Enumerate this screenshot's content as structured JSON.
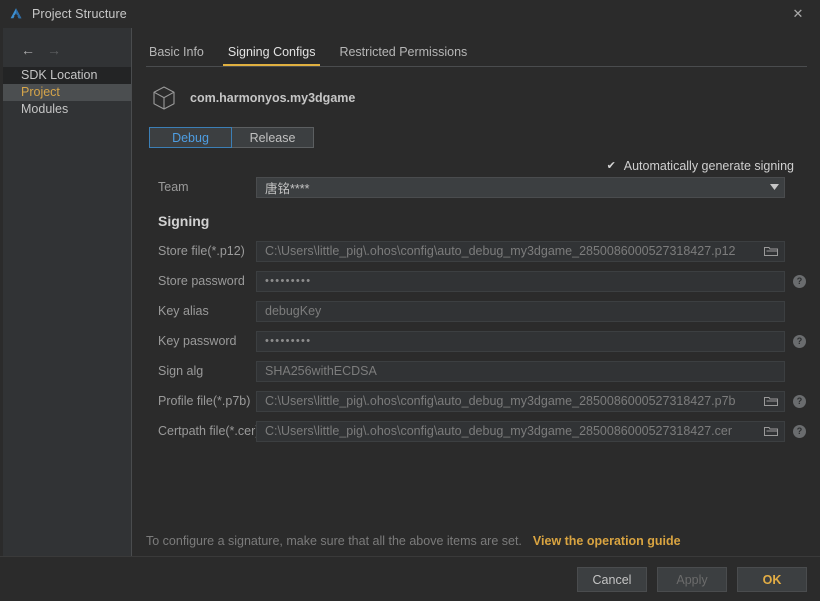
{
  "window": {
    "title": "Project Structure",
    "app_icon": "deveco-logo-icon",
    "close_label": "✕"
  },
  "sidebar": {
    "back_arrow": "←",
    "forward_arrow": "→",
    "items": [
      {
        "label": "SDK Location",
        "selected": false
      },
      {
        "label": "Project",
        "selected": true
      },
      {
        "label": "Modules",
        "selected": false
      }
    ]
  },
  "tabs": [
    {
      "label": "Basic Info",
      "active": false
    },
    {
      "label": "Signing Configs",
      "active": true
    },
    {
      "label": "Restricted Permissions",
      "active": false
    }
  ],
  "main": {
    "package_name": "com.harmonyos.my3dgame",
    "build_variants": [
      {
        "label": "Debug",
        "active": true
      },
      {
        "label": "Release",
        "active": false
      }
    ],
    "auto_generate": {
      "label": "Automatically generate signing",
      "checked": true,
      "check_glyph": "✔"
    },
    "team": {
      "label": "Team",
      "value": "唐铭****",
      "dropdown_glyph": "▼"
    },
    "signing_section_title": "Signing",
    "fields": [
      {
        "label": "Store file(*.p12)",
        "value": "C:\\Users\\little_pig\\.ohos\\config\\auto_debug_my3dgame_2850086000527318427.p12",
        "has_folder": true,
        "has_help": false
      },
      {
        "label": "Store password",
        "value": "•••••••••",
        "masked": true,
        "has_folder": false,
        "has_help": true
      },
      {
        "label": "Key alias",
        "value": "debugKey",
        "has_folder": false,
        "has_help": false
      },
      {
        "label": "Key password",
        "value": "•••••••••",
        "masked": true,
        "has_folder": false,
        "has_help": true
      },
      {
        "label": "Sign alg",
        "value": "SHA256withECDSA",
        "has_folder": false,
        "has_help": false
      },
      {
        "label": "Profile file(*.p7b)",
        "value": "C:\\Users\\little_pig\\.ohos\\config\\auto_debug_my3dgame_2850086000527318427.p7b",
        "has_folder": true,
        "has_help": true
      },
      {
        "label": "Certpath file(*.cer)",
        "value": "C:\\Users\\little_pig\\.ohos\\config\\auto_debug_my3dgame_2850086000527318427.cer",
        "has_folder": true,
        "has_help": true
      }
    ],
    "footer_note": "To configure a signature, make sure that all the above items are set.",
    "footer_link": "View the operation guide",
    "help_glyph": "?"
  },
  "buttons": {
    "cancel": "Cancel",
    "apply": "Apply",
    "ok": "OK"
  },
  "colors": {
    "accent_amber": "#d9a441",
    "accent_blue": "#4e9ee3",
    "bg": "#2b2b2b",
    "sidebar_bg": "#313335",
    "field_bg": "#313335"
  }
}
